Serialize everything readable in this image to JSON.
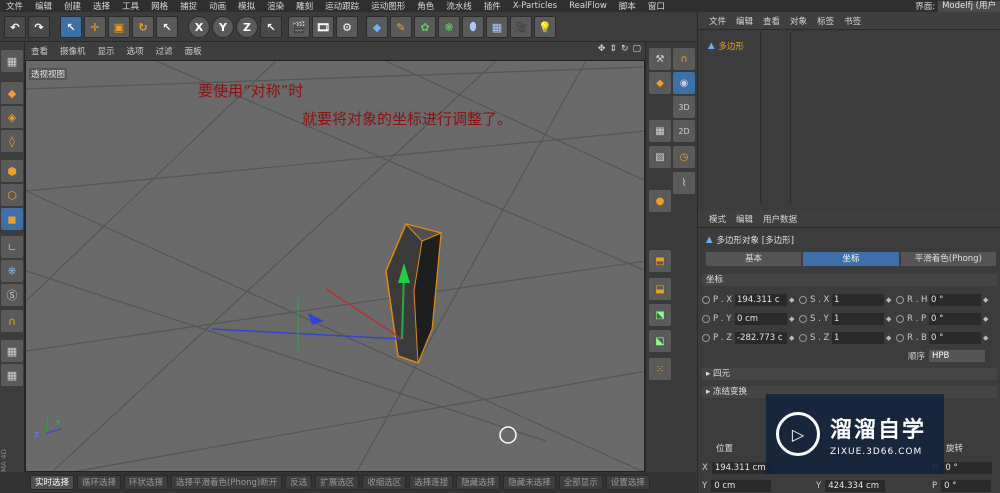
{
  "menubar": {
    "items": [
      "文件",
      "编辑",
      "创建",
      "选择",
      "工具",
      "网格",
      "捕捉",
      "动画",
      "模拟",
      "渲染",
      "雕刻",
      "运动跟踪",
      "运动图形",
      "角色",
      "流水线",
      "插件",
      "X-Particles",
      "RealFlow",
      "脚本",
      "窗口"
    ],
    "layout_label": "界面:",
    "layout_value": "Modelfj (用户"
  },
  "toolbar": {
    "axis_x": "X",
    "axis_y": "Y",
    "axis_z": "Z"
  },
  "viewport_menu": {
    "items": [
      "查看",
      "摄像机",
      "显示",
      "选项",
      "过滤",
      "面板"
    ]
  },
  "viewport": {
    "label": "透视视图",
    "note_line1": "要使用“对称”时",
    "note_line2": "就要将对象的坐标进行调整了。"
  },
  "bottombar": {
    "items": [
      "实时选择",
      "循环选择",
      "环状选择",
      "选择平滑着色(Phong)断开",
      "反选",
      "扩展选区",
      "收缩选区",
      "选择连接",
      "隐藏选择",
      "隐藏未选择",
      "全部显示",
      "设置选择"
    ]
  },
  "object_panel": {
    "menu": [
      "文件",
      "编辑",
      "查看",
      "对象",
      "标签",
      "书签"
    ],
    "object_name": "多边形"
  },
  "attr_panel": {
    "menu": [
      "模式",
      "编辑",
      "用户数据"
    ],
    "title": "多边形对象 [多边形]",
    "tabs": [
      "基本",
      "坐标",
      "平滑着色(Phong)"
    ],
    "section_coord": "坐标",
    "rows": [
      {
        "p_label": "P . X",
        "p_val": "194.311 c",
        "s_label": "S . X",
        "s_val": "1",
        "r_label": "R . H",
        "r_val": "0 °"
      },
      {
        "p_label": "P . Y",
        "p_val": "0 cm",
        "s_label": "S . Y",
        "s_val": "1",
        "r_label": "R . P",
        "r_val": "0 °"
      },
      {
        "p_label": "P . Z",
        "p_val": "-282.773 c",
        "s_label": "S . Z",
        "s_val": "1",
        "r_label": "R . B",
        "r_val": "0 °"
      }
    ],
    "order_label": "顺序",
    "order_value": "HPB",
    "section_quat": "四元",
    "section_freeze": "冻结变换"
  },
  "coord_panel": {
    "header_pos": "位置",
    "header_rot": "旋转",
    "x_label": "X",
    "x_val": "194.311 cm",
    "y_label": "Y",
    "y_val": "0 cm",
    "y2_label": "Y",
    "y2_val": "424.334 cm",
    "rot_label_h": "H",
    "rot_val_h": "0 °",
    "rot_label_p": "P",
    "rot_val_p": "0 °"
  },
  "watermark": {
    "title": "溜溜自学",
    "url": "ZIXUE.3D66.COM"
  },
  "side_vertical": "MA 4D",
  "colors": {
    "accent_blue": "#3d6fa8",
    "note_red": "#8b1212",
    "object_orange": "#f0a020",
    "viewport_grey": "#6a6a6a"
  }
}
